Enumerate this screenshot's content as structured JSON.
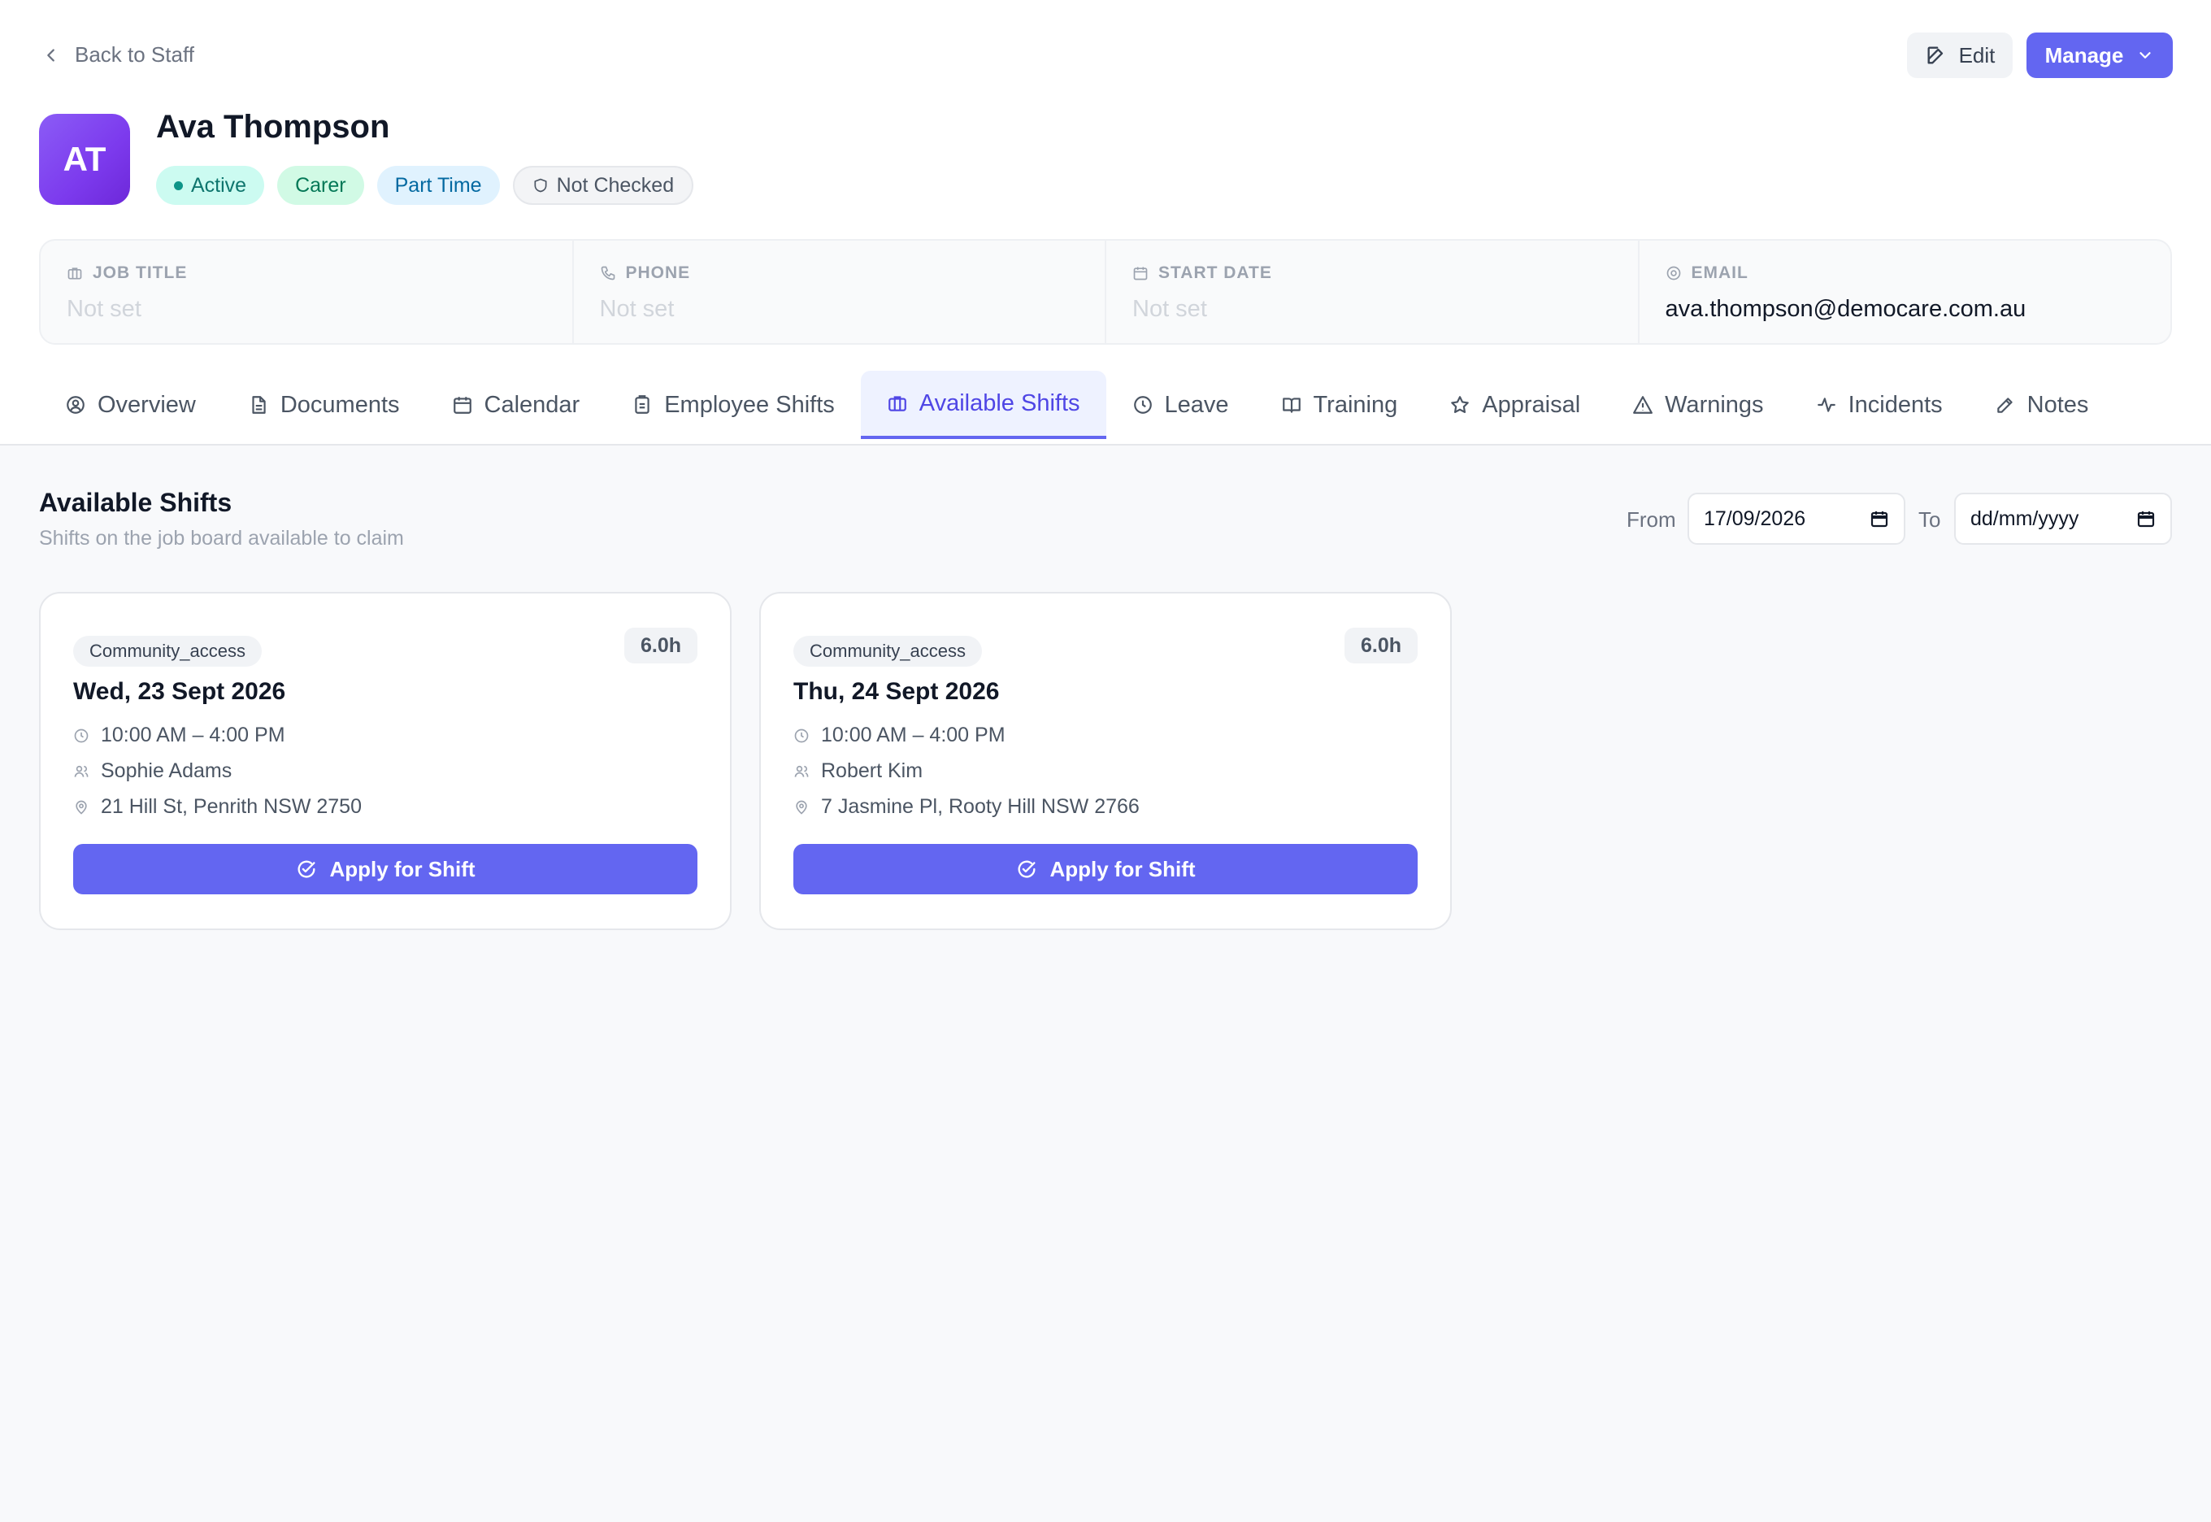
{
  "nav": {
    "back_label": "Back to Staff"
  },
  "header": {
    "edit_label": "Edit",
    "manage_label": "Manage",
    "initials": "AT",
    "name": "Ava Thompson",
    "badges": {
      "status": "Active",
      "role": "Carer",
      "employment": "Part Time",
      "check": "Not Checked"
    }
  },
  "info": {
    "job_title": {
      "label": "JOB TITLE",
      "value": "Not set"
    },
    "phone": {
      "label": "PHONE",
      "value": "Not set"
    },
    "start_date": {
      "label": "START DATE",
      "value": "Not set"
    },
    "email": {
      "label": "EMAIL",
      "value": "ava.thompson@democare.com.au"
    }
  },
  "tabs": [
    {
      "label": "Overview",
      "icon": "user-circle-icon"
    },
    {
      "label": "Documents",
      "icon": "file-icon"
    },
    {
      "label": "Calendar",
      "icon": "calendar-icon"
    },
    {
      "label": "Employee Shifts",
      "icon": "clipboard-icon"
    },
    {
      "label": "Available Shifts",
      "icon": "briefcase-icon",
      "active": true
    },
    {
      "label": "Leave",
      "icon": "clock-icon"
    },
    {
      "label": "Training",
      "icon": "book-icon"
    },
    {
      "label": "Appraisal",
      "icon": "star-icon"
    },
    {
      "label": "Warnings",
      "icon": "warning-icon"
    },
    {
      "label": "Incidents",
      "icon": "activity-icon"
    },
    {
      "label": "Notes",
      "icon": "pencil-icon"
    }
  ],
  "section": {
    "title": "Available Shifts",
    "subtitle": "Shifts on the job board available to claim",
    "from_label": "From",
    "from_value": "17/09/2026",
    "to_label": "To",
    "to_value": "dd/mm/yyyy"
  },
  "shifts": [
    {
      "service": "Community_access",
      "hours": "6.0h",
      "date": "Wed, 23 Sept 2026",
      "time": "10:00 AM – 4:00 PM",
      "client": "Sophie Adams",
      "address": "21 Hill St, Penrith NSW 2750",
      "apply_label": "Apply for Shift"
    },
    {
      "service": "Community_access",
      "hours": "6.0h",
      "date": "Thu, 24 Sept 2026",
      "time": "10:00 AM – 4:00 PM",
      "client": "Robert Kim",
      "address": "7 Jasmine Pl, Rooty Hill NSW 2766",
      "apply_label": "Apply for Shift"
    }
  ],
  "colors": {
    "accent": "#6366f1",
    "avatar": "#7c3aed",
    "active_badge": "#ccfbf1",
    "role_badge": "#d1fae5",
    "type_badge": "#e0f2fe"
  }
}
